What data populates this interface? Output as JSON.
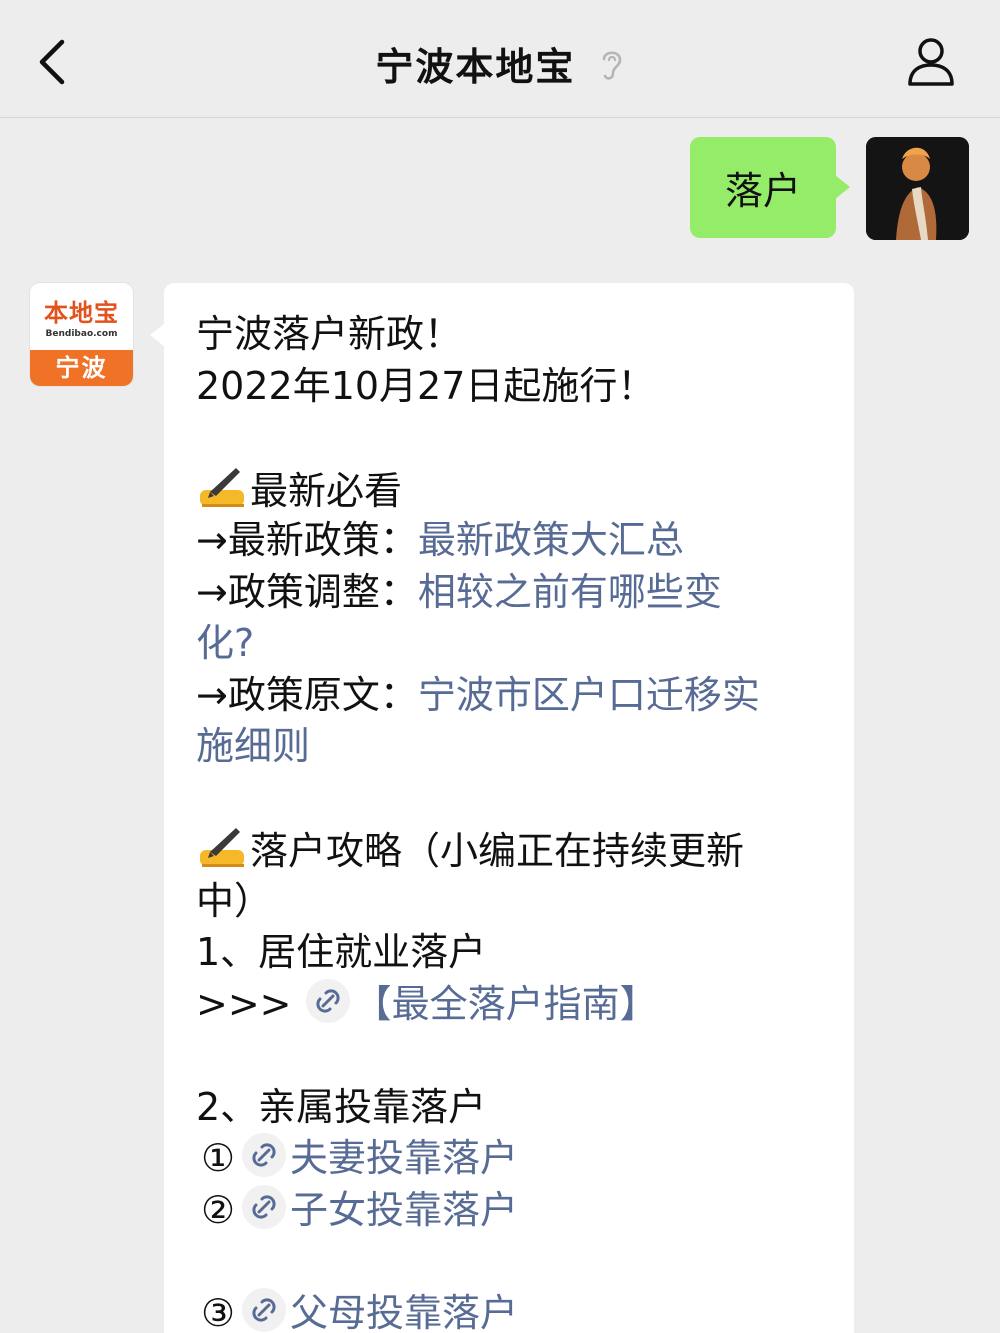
{
  "header": {
    "title": "宁波本地宝",
    "icons": {
      "back": "chevron-left-icon",
      "listen": "ear-icon",
      "profile": "person-icon"
    }
  },
  "sent_message": {
    "text": "落户"
  },
  "bot_avatar": {
    "logo_text": "本地宝",
    "logo_url": "Bendibao.com",
    "city": "宁波"
  },
  "message": {
    "headline": "宁波落户新政！",
    "date_line": "2022年10月27日起施行！",
    "latest_heading": "最新必看",
    "latest_items": [
      {
        "arrow": "→",
        "label": "最新政策：",
        "link": "最新政策大汇总"
      },
      {
        "arrow": "→",
        "label": "政策调整：",
        "link": "相较之前有哪些变",
        "link_cont": "化?"
      },
      {
        "arrow": "→",
        "label": "政策原文：",
        "link": "宁波市区户口迁移实",
        "link_cont": "施细则"
      }
    ],
    "guide_heading": "落户攻略（小编正在持续更新",
    "guide_heading_cont": "中）",
    "section1_title": "1、居住就业落户",
    "section1_prefix": ">>>",
    "section1_link": "【最全落户指南】",
    "section2_title": "2、亲属投靠落户",
    "section2_items": [
      {
        "num": "①",
        "link": "夫妻投靠落户"
      },
      {
        "num": "②",
        "link": "子女投靠落户"
      },
      {
        "num": "③",
        "link": "父母投靠落户"
      }
    ]
  },
  "colors": {
    "link": "#576b95",
    "sent_bubble": "#95ec69",
    "background": "#ededed"
  }
}
